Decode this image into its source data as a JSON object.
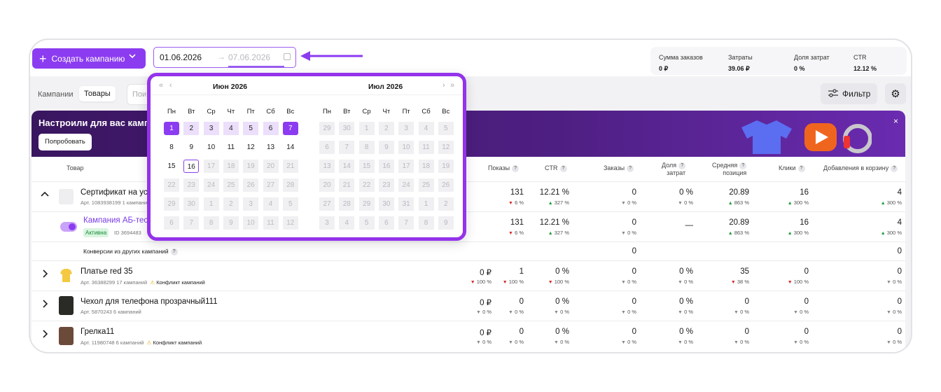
{
  "toolbar": {
    "create_label": "Создать кампанию",
    "date_from": "01.06.2026",
    "date_to": "07.06.2026"
  },
  "stats": [
    {
      "label": "Сумма заказов",
      "value": "0 ₽"
    },
    {
      "label": "Затраты",
      "value": "39.06 ₽"
    },
    {
      "label": "Доля затрат",
      "value": "0 %"
    },
    {
      "label": "CTR",
      "value": "12.12 %"
    }
  ],
  "tabs": {
    "campaigns": "Кампании",
    "products": "Товары"
  },
  "search": {
    "placeholder": "Пои"
  },
  "filter_label": "Фильтр",
  "banner": {
    "title": "Настроили для вас кампан",
    "button": "Попробовать",
    "close": "×"
  },
  "headers": {
    "product": "Товар",
    "shows": "Показы",
    "ctr": "CTR",
    "orders": "Заказы",
    "share_1": "Доля",
    "share_2": "затрат",
    "position_1": "Средняя",
    "position_2": "позиция",
    "clicks": "Клики",
    "cart": "Добавления в корзину"
  },
  "rows": {
    "cert": {
      "name": "Сертификат на усл",
      "sub": "Арт. 1083938199  1 кампани",
      "shows": "131",
      "shows_d": "6 %",
      "ctr": "12.21 %",
      "ctr_d": "327 %",
      "orders": "0",
      "orders_d": "0 %",
      "share": "0 %",
      "share_d": "0 %",
      "pos": "20.89",
      "pos_d": "863 %",
      "clicks": "16",
      "clicks_d": "300 %",
      "cart": "4",
      "cart_d": "300 %"
    },
    "camp": {
      "name": "Кампания АБ-тест",
      "status": "Активна",
      "id": "ID 3694483",
      "shows": "131",
      "shows_d": "6 %",
      "ctr": "12.21 %",
      "ctr_d": "327 %",
      "orders": "0",
      "orders_d": "0 %",
      "share": "—",
      "pos": "20.89",
      "pos_d": "863 %",
      "clicks": "16",
      "clicks_d": "300 %",
      "cart": "4",
      "cart_d": "300 %"
    },
    "conv": {
      "label": "Конверсии из других кампаний",
      "orders": "0",
      "cart": "0"
    },
    "dress": {
      "name": "Платье red 35",
      "sub": "Арт. 36388299  17 кампаний",
      "conflict": "Конфликт кампаний",
      "sum": "0 ₽",
      "sum_d": "100 %",
      "shows": "1",
      "shows_d": "100 %",
      "ctr": "0 %",
      "ctr_d": "100 %",
      "orders": "0",
      "orders_d": "0 %",
      "share": "0 %",
      "share_d": "0 %",
      "pos": "35",
      "pos_d": "38 %",
      "clicks": "0",
      "clicks_d": "100 %",
      "cart": "0",
      "cart_d": "0 %"
    },
    "case": {
      "name": "Чехол для телефона прозрачный111",
      "sub": "Арт. 5870243  6 кампаний",
      "sum": "0 ₽",
      "sum_d": "0 %",
      "shows": "0",
      "shows_d": "0 %",
      "ctr": "0 %",
      "ctr_d": "0 %",
      "orders": "0",
      "orders_d": "0 %",
      "share": "0 %",
      "share_d": "0 %",
      "pos": "0",
      "pos_d": "0 %",
      "clicks": "0",
      "clicks_d": "0 %",
      "cart": "0",
      "cart_d": "0 %"
    },
    "heater": {
      "name": "Грелка11",
      "sub": "Арт. 11980748  6 кампаний",
      "conflict": "Конфликт кампаний",
      "sum": "0 ₽",
      "sum_d": "0 %",
      "shows": "0",
      "shows_d": "0 %",
      "ctr": "0 %",
      "ctr_d": "0 %",
      "orders": "0",
      "orders_d": "0 %",
      "share": "0 %",
      "share_d": "0 %",
      "pos": "0",
      "pos_d": "0 %",
      "clicks": "0",
      "clicks_d": "0 %",
      "cart": "0",
      "cart_d": "0 %"
    }
  },
  "calendar": {
    "left_month": "Июн  2026",
    "right_month": "Июл  2026",
    "weekdays": [
      "Пн",
      "Вт",
      "Ср",
      "Чт",
      "Пт",
      "Сб",
      "Вс"
    ],
    "june": [
      [
        "1",
        "2",
        "3",
        "4",
        "5",
        "6",
        "7"
      ],
      [
        "8",
        "9",
        "10",
        "11",
        "12",
        "13",
        "14"
      ],
      [
        "15",
        "16",
        "17",
        "18",
        "19",
        "20",
        "21"
      ],
      [
        "22",
        "23",
        "24",
        "25",
        "26",
        "27",
        "28"
      ],
      [
        "29",
        "30",
        "1",
        "2",
        "3",
        "4",
        "5"
      ],
      [
        "6",
        "7",
        "8",
        "9",
        "10",
        "11",
        "12"
      ]
    ],
    "july": [
      [
        "29",
        "30",
        "1",
        "2",
        "3",
        "4",
        "5"
      ],
      [
        "6",
        "7",
        "8",
        "9",
        "10",
        "11",
        "12"
      ],
      [
        "13",
        "14",
        "15",
        "16",
        "17",
        "18",
        "19"
      ],
      [
        "20",
        "21",
        "22",
        "23",
        "24",
        "25",
        "26"
      ],
      [
        "27",
        "28",
        "29",
        "30",
        "31",
        "1",
        "2"
      ],
      [
        "3",
        "4",
        "5",
        "6",
        "7",
        "8",
        "9"
      ]
    ],
    "selected_start": 1,
    "selected_end": 7,
    "today": 16
  },
  "colors": {
    "accent": "#8c3cf0",
    "up": "#1a9e3a",
    "down": "#d62c2c"
  }
}
